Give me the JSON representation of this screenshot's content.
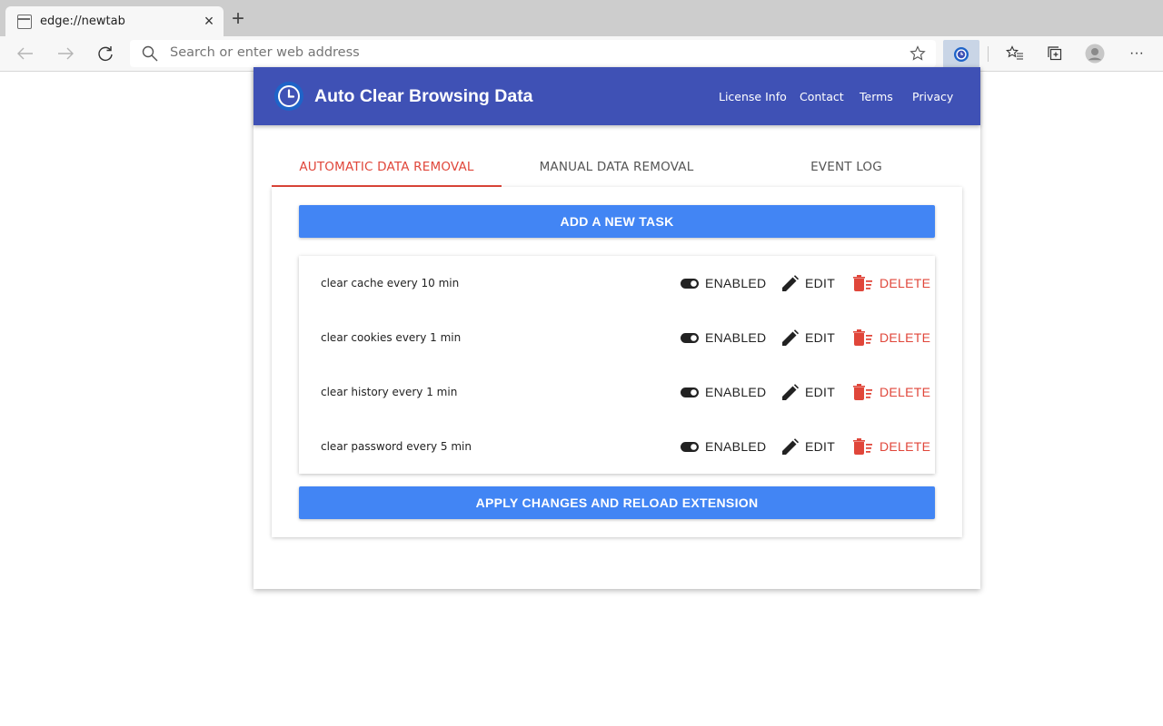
{
  "browser": {
    "tab_title": "edge://newtab",
    "tab_close": "×",
    "new_tab": "+",
    "address_placeholder": "Search or enter web address",
    "more_label": "···"
  },
  "app": {
    "title": "Auto Clear Browsing Data",
    "header_links": [
      "License Info",
      "Contact",
      "Terms",
      "Privacy"
    ],
    "accent_color": "#3f51b5",
    "primary_color": "#4285f4",
    "danger_color": "#e0463a"
  },
  "tabs": [
    {
      "label": "AUTOMATIC DATA REMOVAL",
      "active": true
    },
    {
      "label": "MANUAL DATA REMOVAL",
      "active": false
    },
    {
      "label": "EVENT LOG",
      "active": false
    }
  ],
  "add_task_label": "ADD A NEW TASK",
  "tasks": [
    {
      "label": "clear cache every 10 min",
      "status": "ENABLED",
      "edit": "EDIT",
      "delete": "DELETE"
    },
    {
      "label": "clear cookies every 1 min",
      "status": "ENABLED",
      "edit": "EDIT",
      "delete": "DELETE"
    },
    {
      "label": "clear history every 1 min",
      "status": "ENABLED",
      "edit": "EDIT",
      "delete": "DELETE"
    },
    {
      "label": "clear password every 5 min",
      "status": "ENABLED",
      "edit": "EDIT",
      "delete": "DELETE"
    }
  ],
  "apply_label": "APPLY CHANGES AND RELOAD EXTENSION"
}
